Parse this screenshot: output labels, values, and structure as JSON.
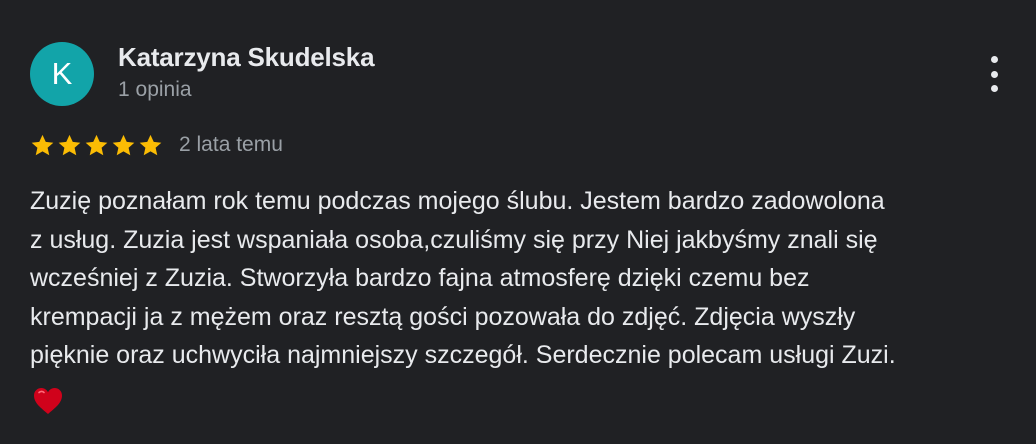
{
  "review": {
    "avatar_letter": "K",
    "avatar_color": "#12a4a9",
    "author_name": "Katarzyna Skudelska",
    "author_meta": "1 opinia",
    "more_icon": "more-vert-icon",
    "rating": 5,
    "rating_max": 5,
    "star_color": "#fbbc04",
    "date": "2 lata temu",
    "text": "Zuzię poznałam rok temu podczas mojego ślubu. Jestem bardzo zadowolona\nz usług. Zuzia jest wspaniała osoba,czuliśmy się przy Niej jakbyśmy znali się\nwcześniej z Zuzia. Stworzyła bardzo fajna atmosferę dzięki czemu bez\nkrempacji ja z mężem oraz resztą gości pozowała do zdjęć. Zdjęcia wyszły\npięknie oraz uchwyciła najmniejszy szczegół. Serdecznie polecam usługi Zuzi.",
    "emoji": "red-heart-icon"
  }
}
